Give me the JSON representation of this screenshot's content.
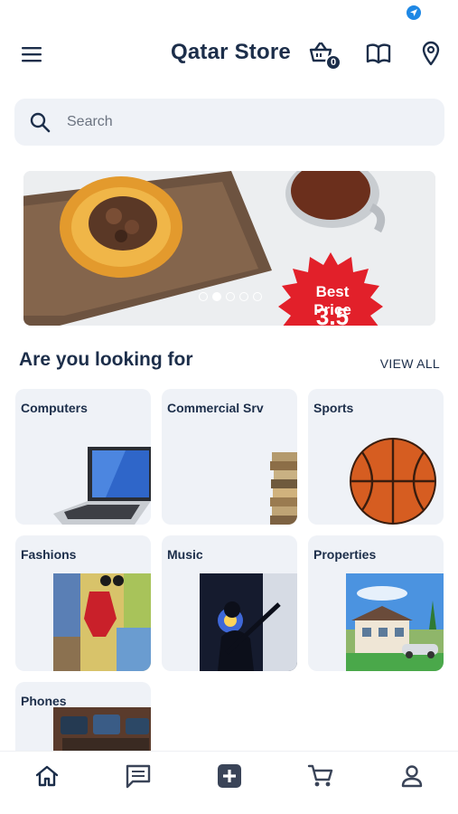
{
  "header": {
    "title": "Qatar Store",
    "cart_count": "0"
  },
  "search": {
    "placeholder": "Search"
  },
  "banner": {
    "price_label": "Best Price",
    "price_value": "3.5",
    "slides": 5,
    "active_slide": 2
  },
  "categories_section": {
    "title": "Are you looking for",
    "view_all": "VIEW ALL"
  },
  "categories": [
    {
      "label": "Computers",
      "image": "laptop"
    },
    {
      "label": "Commercial Srv",
      "image": "books"
    },
    {
      "label": "Sports",
      "image": "basketball"
    },
    {
      "label": "Fashions",
      "image": "clothes"
    },
    {
      "label": "Music",
      "image": "guitarist"
    },
    {
      "label": "Properties",
      "image": "house"
    },
    {
      "label": "Phones",
      "image": "phones"
    }
  ],
  "bottom_nav": [
    "home-icon",
    "chat-icon",
    "add-icon",
    "cart-icon",
    "profile-icon"
  ],
  "colors": {
    "primary": "#1c2e4a",
    "card_bg": "#eff2f7",
    "badge_red": "#e2202a",
    "status_blue": "#1e88e5"
  }
}
